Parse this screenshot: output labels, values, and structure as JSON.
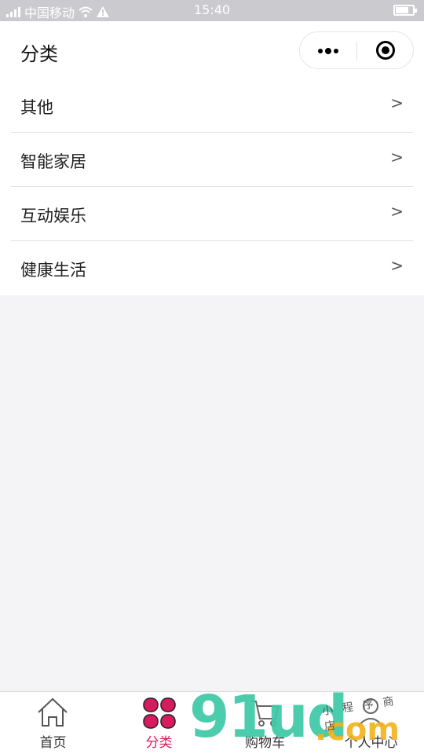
{
  "status_bar": {
    "carrier": "中国移动",
    "time": "15:40"
  },
  "nav": {
    "title": "分类"
  },
  "categories": [
    {
      "label": "其他",
      "arrow": ">"
    },
    {
      "label": "智能家居",
      "arrow": ">"
    },
    {
      "label": "互动娱乐",
      "arrow": ">"
    },
    {
      "label": "健康生活",
      "arrow": ">"
    }
  ],
  "tabbar": {
    "tabs": [
      {
        "label": "首页",
        "icon": "home-icon"
      },
      {
        "label": "分类",
        "icon": "clover-category-icon",
        "active": true
      },
      {
        "label": "购物车",
        "icon": "cart-icon"
      },
      {
        "label": "个人中心",
        "icon": "user-icon"
      }
    ],
    "active_color": "#d81b5e"
  },
  "watermark": {
    "brand": "91ud",
    "domain": ".com",
    "script_text": "小程序商店"
  }
}
